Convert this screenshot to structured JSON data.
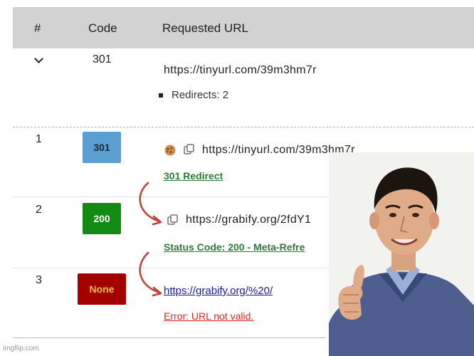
{
  "header": {
    "col_index": "#",
    "col_code": "Code",
    "col_url": "Requested URL"
  },
  "summary": {
    "code": "301",
    "url": "https://tinyurl.com/39m3hm7r",
    "redirects_label": "Redirects: 2"
  },
  "rows": [
    {
      "index": "1",
      "code": "301",
      "badge_color": "#5a9fd0",
      "url": "https://tinyurl.com/39m3hm7r",
      "status": "301 Redirect"
    },
    {
      "index": "2",
      "code": "200",
      "badge_color": "#138a13",
      "url": "https://grabify.org/2fdY1",
      "status": "Status Code: 200 - Meta-Refre"
    },
    {
      "index": "3",
      "code": "None",
      "badge_color": "#a30000",
      "badge_text_color": "#f0c040",
      "url": "https://grabify.org/%20/",
      "status": "Error: URL not valid."
    }
  ],
  "watermark": "imgflip.com"
}
